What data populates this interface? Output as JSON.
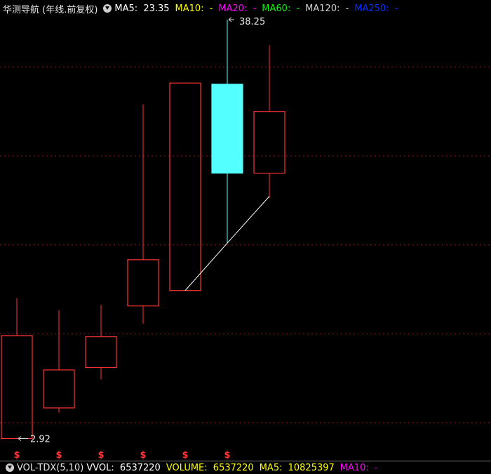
{
  "legend": {
    "title": "华测导航 (年线.前复权)",
    "ma5": {
      "label": "MA5:",
      "value": "23.35",
      "color": "#ffffff"
    },
    "ma10": {
      "label": "MA10:",
      "value": "-",
      "color": "#ffff00"
    },
    "ma20": {
      "label": "MA20:",
      "value": "-",
      "color": "#ff00ff"
    },
    "ma60": {
      "label": "MA60:",
      "value": "-",
      "color": "#00ff00"
    },
    "ma120": {
      "label": "MA120:",
      "value": "-",
      "color": "#d0d0d0"
    },
    "ma250": {
      "label": "MA250:",
      "value": "-",
      "color": "#0033ff"
    }
  },
  "volume_bar": {
    "name": "VOL-TDX(5,10)",
    "vvol_label": "VVOL:",
    "vvol_value": "6537220",
    "volume_label": "VOLUME:",
    "volume_value": "6537220",
    "ma5_label": "MA5:",
    "ma5_value": "10825397",
    "ma10_label": "MA10:",
    "ma10_value": "-"
  },
  "colors": {
    "up": "#ff3333",
    "down": "#54ffff",
    "ma5": "#ffffff",
    "marker": "#ff3333",
    "grid": "#8a1a1a"
  },
  "chart_data": {
    "type": "candlestick",
    "ylim": [
      2.0,
      38.6
    ],
    "candles": [
      {
        "open": 2.92,
        "close": 11.6,
        "high": 14.75,
        "low": 2.92
      },
      {
        "open": 5.5,
        "close": 8.7,
        "high": 13.75,
        "low": 5.1
      },
      {
        "open": 8.9,
        "close": 11.5,
        "high": 14.2,
        "low": 7.9
      },
      {
        "open": 14.1,
        "close": 18.0,
        "high": 31.1,
        "low": 12.6
      },
      {
        "open": 15.4,
        "close": 32.9,
        "high": 32.9,
        "low": 15.4
      },
      {
        "open": 32.8,
        "close": 25.3,
        "high": 38.25,
        "low": 19.4
      },
      {
        "open": 25.3,
        "close": 30.5,
        "high": 36.1,
        "low": 23.2
      }
    ],
    "ma5": [
      null,
      null,
      null,
      null,
      15.4,
      19.4,
      23.35
    ],
    "annotations": {
      "high": {
        "value": 38.25,
        "label": "38.25"
      },
      "low": {
        "value": 2.92,
        "label": "2.92"
      }
    },
    "gridlines": [
      4.25,
      11.75,
      19.25,
      26.75,
      34.25
    ],
    "marker_symbol": "$",
    "markers": [
      0,
      1,
      2,
      3,
      4,
      5
    ]
  }
}
